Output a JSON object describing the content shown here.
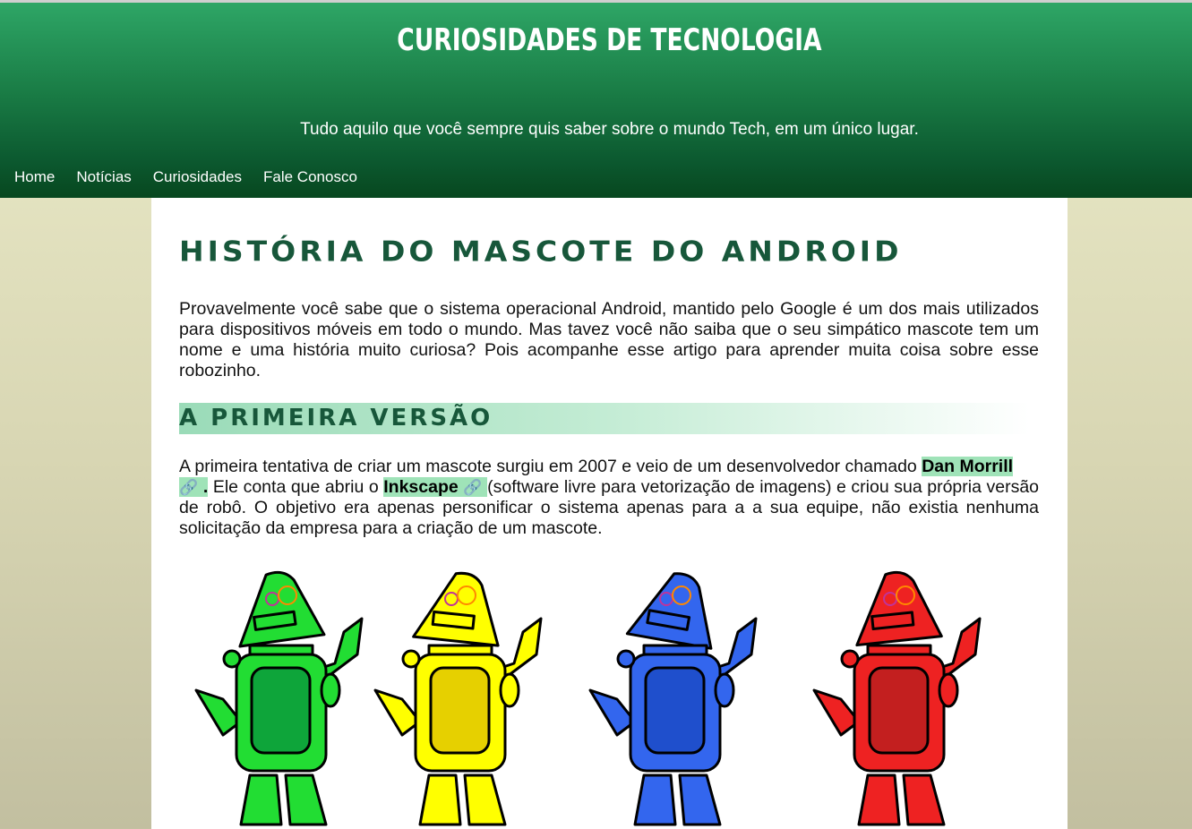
{
  "header": {
    "title": "CURIOSIDADES DE TECNOLOGIA",
    "subtitle": "Tudo aquilo que você sempre quis saber sobre o mundo Tech, em um único lugar."
  },
  "nav": {
    "items": [
      {
        "label": "Home"
      },
      {
        "label": "Notícias"
      },
      {
        "label": "Curiosidades"
      },
      {
        "label": "Fale Conosco"
      }
    ]
  },
  "article": {
    "title": "História do mascote do Android",
    "intro": "Provavelmente você sabe que o sistema operacional Android, mantido pelo Google é um dos mais utilizados para dispositivos móveis em todo o mundo. Mas tavez você não saiba que o seu simpático mascote tem um nome e uma história muito curiosa? Pois acompanhe esse artigo para aprender muita coisa sobre esse robozinho.",
    "section1": {
      "heading": "A primeira versão",
      "p_before": "A primeira tentativa de criar um mascote surgiu em 2007 e veio de um desenvolvedor chamado ",
      "link1": "Dan Morrill",
      "link1_suffix": ".",
      "p_middle": " Ele conta que abriu o ",
      "link2": "Inkscape",
      "p_after": " (software livre para vetorização de imagens) e criou sua própria versão de robô. O objetivo era apenas personificar o sistema apenas para a a sua equipe, não existia nenhuma solicitação da empresa para a criação de um mascote.",
      "link_icon": "🔗"
    }
  },
  "image": {
    "robot_colors": [
      "#22dd33",
      "#ffff00",
      "#3366ee",
      "#ee2222"
    ],
    "robot_dark_colors": [
      "#0ea53a",
      "#e6d000",
      "#1f4fcc",
      "#c31f1f"
    ]
  }
}
